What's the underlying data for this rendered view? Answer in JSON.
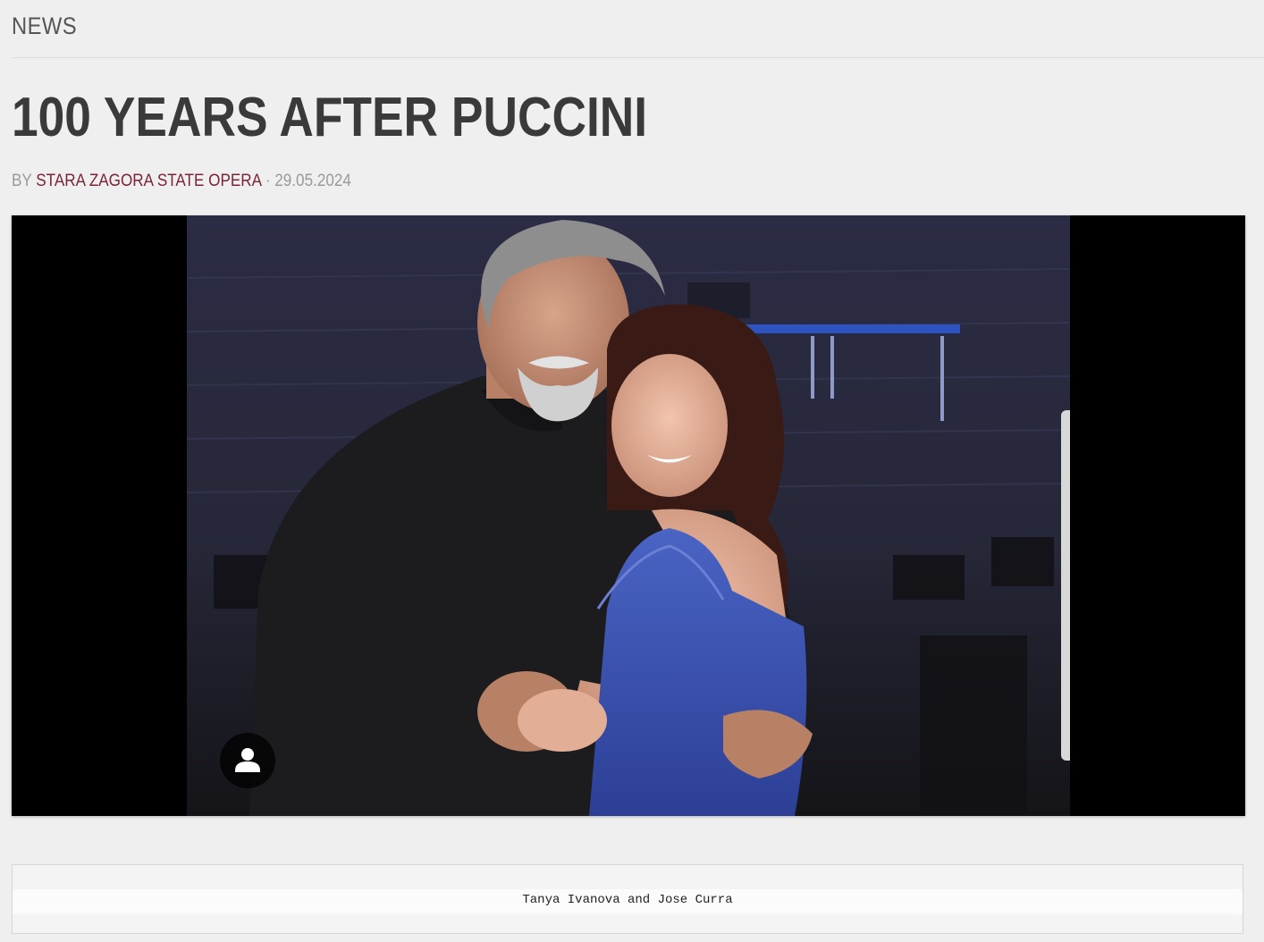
{
  "section": {
    "label": "NEWS"
  },
  "article": {
    "title": "100 YEARS AFTER PUCCINI",
    "byline_prefix": "BY",
    "author": "STARA ZAGORA STATE OPERA",
    "separator": "·",
    "date": "29.05.2024"
  },
  "media": {
    "user_icon": "user-icon",
    "caption": "Tanya Ivanova and Jose Curra"
  },
  "colors": {
    "background": "#efefef",
    "title": "#3a3a3a",
    "author_link": "#7a2435",
    "muted": "#9a9a9a"
  }
}
